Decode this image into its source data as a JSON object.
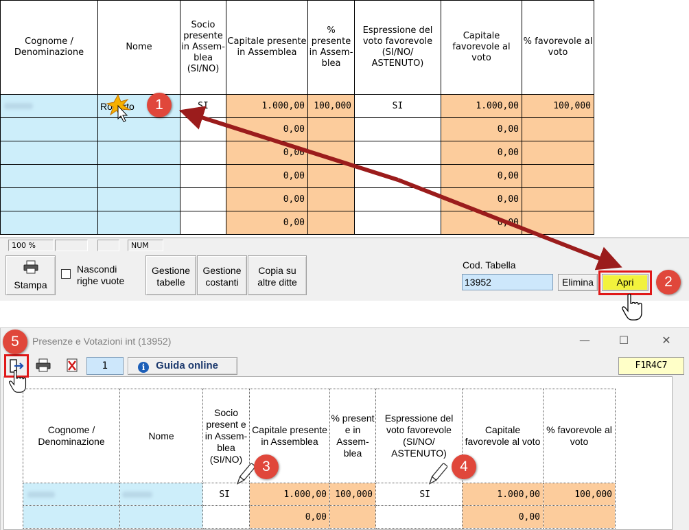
{
  "grid1": {
    "headers": {
      "cognome": "Cognome / Denominazione",
      "nome": "Nome",
      "socio": "Socio presente in Assem-blea (SI/NO)",
      "capitale": "Capitale presente in Assemblea",
      "perc": "% presente in Assem-blea",
      "espressione": "Espressione del voto favorevole (SI/NO/ ASTENUTO)",
      "capfav": "Capitale favorevole al voto",
      "percfav": "% favorevole al voto"
    },
    "row1": {
      "nome": "Roberto",
      "socio": "SI",
      "capitale": "1.000,00",
      "perc": "100,000",
      "espressione": "SI",
      "capfav": "1.000,00",
      "percfav": "100,000"
    },
    "zero": "0,00"
  },
  "statusbar": {
    "zoom": "100 %",
    "num": "NUM"
  },
  "toolbar": {
    "stampa": "Stampa",
    "nascondi_line1": "Nascondi",
    "nascondi_line2": "righe vuote",
    "gestione_tabelle_1": "Gestione",
    "gestione_tabelle_2": "tabelle",
    "gestione_costanti_1": "Gestione",
    "gestione_costanti_2": "costanti",
    "copia_1": "Copia su",
    "copia_2": "altre ditte",
    "cod_label": "Cod. Tabella",
    "cod_value": "13952",
    "elimina": "Elimina",
    "apri": "Apri"
  },
  "window2": {
    "title": "Presenze e Votazioni int (13952)",
    "page": "1",
    "guida": "Guida online",
    "cell_ref": "F1R4C7",
    "headers": {
      "cognome": "Cognome / Denominazione",
      "nome": "Nome",
      "socio": "Socio present e in Assem-blea (SI/NO)",
      "capitale": "Capitale presente in Assemblea",
      "perc": "% present e in Assem-blea",
      "espressione": "Espressione del voto favorevole (SI/NO/ ASTENUTO)",
      "capfav": "Capitale favorevole al voto",
      "percfav": "% favorevole al voto"
    },
    "row1": {
      "socio": "SI",
      "capitale": "1.000,00",
      "perc": "100,000",
      "espressione": "SI",
      "capfav": "1.000,00",
      "percfav": "100,000"
    },
    "zero": "0,00"
  },
  "annotations": {
    "b1": "1",
    "b2": "2",
    "b3": "3",
    "b4": "4",
    "b5": "5"
  },
  "colors": {
    "cyan": "#cdeefa",
    "peach": "#fccc9c",
    "badge": "#e0473b",
    "arrow": "#9b1c1c",
    "cod_input": "#cde7fb",
    "apri": "#f2f23c"
  }
}
